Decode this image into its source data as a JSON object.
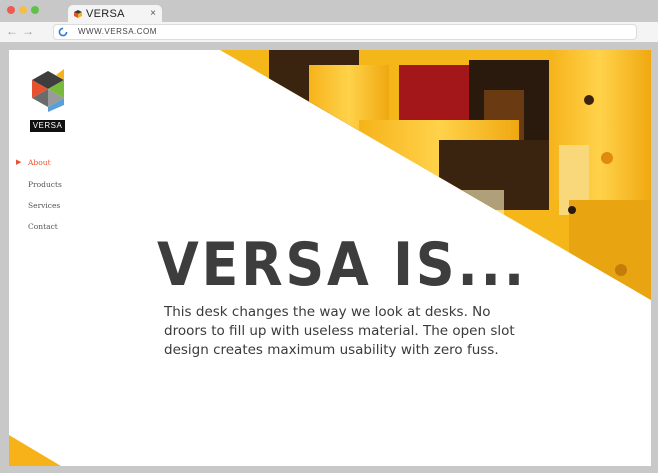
{
  "browser": {
    "tab_title": "VERSA",
    "tab_close": "×",
    "back_glyph": "←",
    "forward_glyph": "→",
    "url": "WWW.VERSA.COM"
  },
  "site": {
    "logo_text": "VERSA",
    "nav": [
      {
        "label": "About",
        "active": true
      },
      {
        "label": "Products",
        "active": false
      },
      {
        "label": "Services",
        "active": false
      },
      {
        "label": "Contact",
        "active": false
      }
    ],
    "nav_active_marker": "▶",
    "headline": "VERSA IS...",
    "body": "This desk changes the way we look at desks. No droors to fill up with useless material. The open slot design creates maximum usability with zero fuss."
  },
  "colors": {
    "accent": "#e8512f",
    "brand_yellow": "#f7b21a",
    "text_dark": "#3d3d3d"
  }
}
